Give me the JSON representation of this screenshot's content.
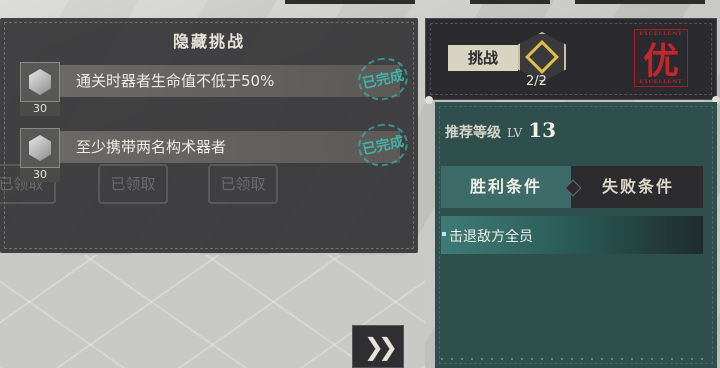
{
  "hidden_challenge": {
    "title": "隐藏挑战",
    "tasks": [
      {
        "text": "通关时器者生命值不低于50%",
        "count": "30",
        "stamp": "已完成"
      },
      {
        "text": "至少携带两名构术器者",
        "count": "30",
        "stamp": "已完成"
      }
    ],
    "background_buttons": [
      "已领取",
      "已领取",
      "已领取"
    ]
  },
  "mission": {
    "challenge_label": "挑战",
    "challenge_progress": "2/2",
    "grade": {
      "char": "优",
      "sub_top": "EXCELLENT",
      "sub_bottom": "EXCELLENT"
    },
    "recommended_label": "推荐等级",
    "lv_label": "LV",
    "recommended_level": "13",
    "tabs": {
      "victory": "胜利条件",
      "defeat": "失败条件"
    },
    "victory_conditions": [
      "击退敌方全员"
    ]
  },
  "colors": {
    "teal_accent": "#3fb3aa",
    "grade_red": "#c1272d",
    "panel_dark": "#2b2a2e",
    "body_teal": "#2f4f4c"
  },
  "icons": {
    "next": "double-chevron-right-icon"
  }
}
